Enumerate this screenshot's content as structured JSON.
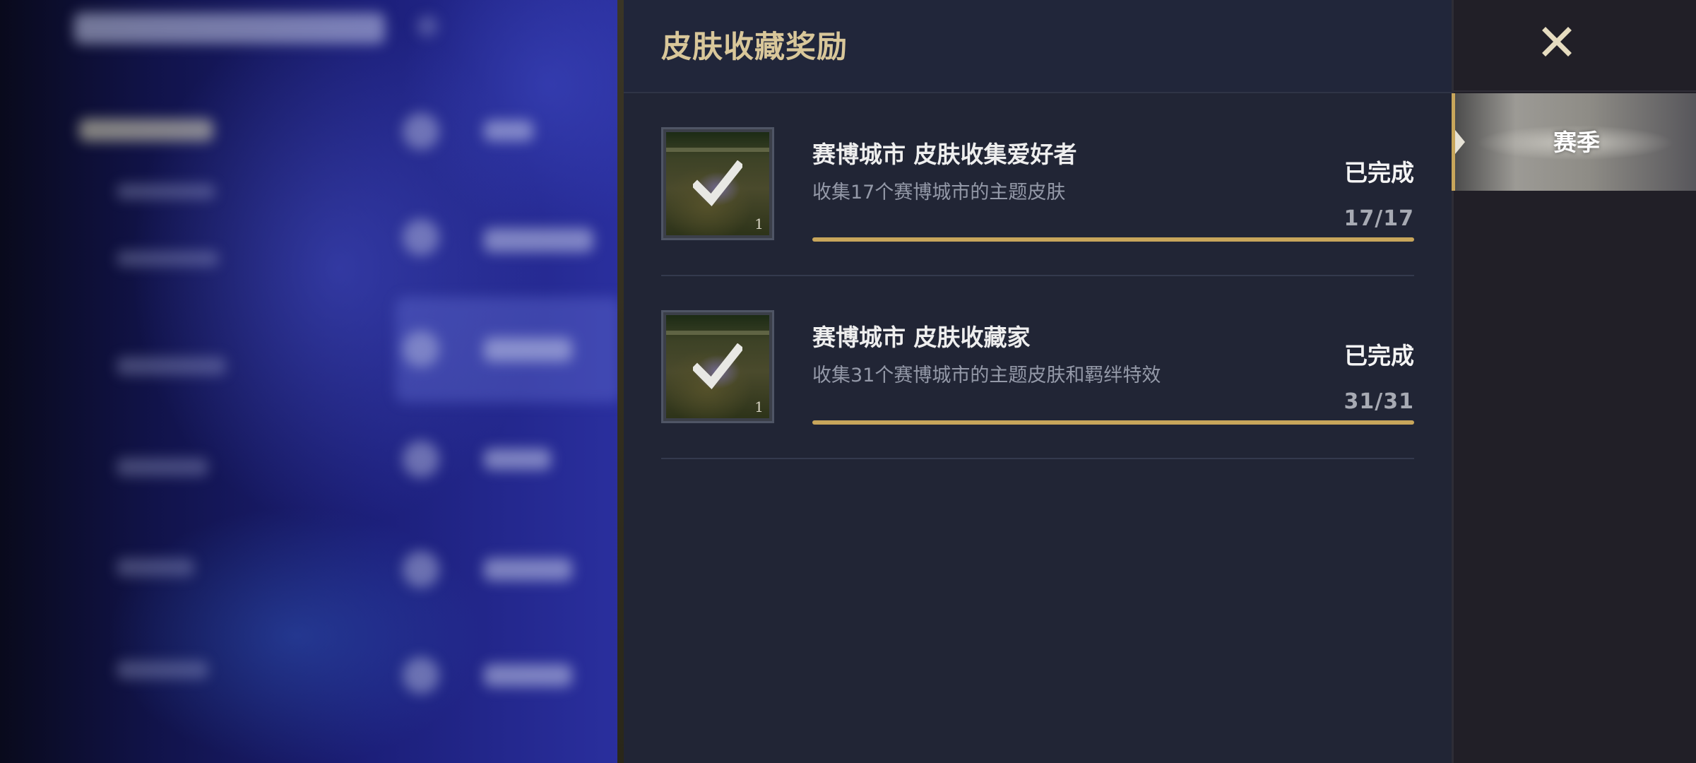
{
  "panel": {
    "title": "皮肤收藏奖励"
  },
  "rewards": [
    {
      "icon_count": "1",
      "title": "赛博城市 皮肤收集爱好者",
      "description": "收集17个赛博城市的主题皮肤",
      "status": "已完成",
      "progress_text": "17/17",
      "progress_fraction": 1.0
    },
    {
      "icon_count": "1",
      "title": "赛博城市 皮肤收藏家",
      "description": "收集31个赛博城市的主题皮肤和羁绊特效",
      "status": "已完成",
      "progress_text": "31/31",
      "progress_fraction": 1.0
    }
  ],
  "side": {
    "close_icon": "close-icon",
    "tabs": [
      {
        "label": "赛季",
        "selected": true
      }
    ]
  },
  "colors": {
    "title_gold": "#d9c79a",
    "progress_gold": "#c8a65b",
    "panel_bg": "#212535",
    "side_bg": "#211f27"
  }
}
